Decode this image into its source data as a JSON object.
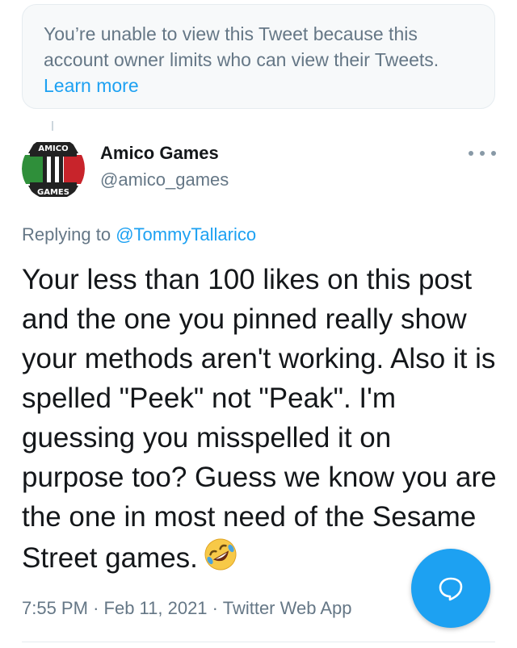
{
  "notice": {
    "text": "You’re unable to view this Tweet because this account owner limits who can view their Tweets.",
    "link": "Learn more"
  },
  "tweet": {
    "avatar_icon": "amico-games-logo-icon",
    "avatar_text_top": "AMICO",
    "avatar_text_bottom": "GAMES",
    "name": "Amico Games",
    "handle": "@amico_games",
    "replying_prefix": "Replying to",
    "replying_to": "@TommyTallarico",
    "body": "Your less than 100 likes on this post and the one you pinned really show your methods aren't working. Also it is spelled \"Peek\" not \"Peak\". I'm guessing you misspelled it on purpose too? Guess we know you are the one in most need of the Sesame Street games.",
    "emoji": "rolling-on-floor-laughing-emoji",
    "time": "7:55 PM",
    "date": "Feb 11, 2021",
    "source": "Twitter Web App",
    "separator": "·"
  },
  "compose_fab": {
    "icon": "reply-bubble-icon"
  },
  "colors": {
    "accent": "#1da1f2",
    "secondary_text": "#657786",
    "primary_text": "#14171a"
  }
}
